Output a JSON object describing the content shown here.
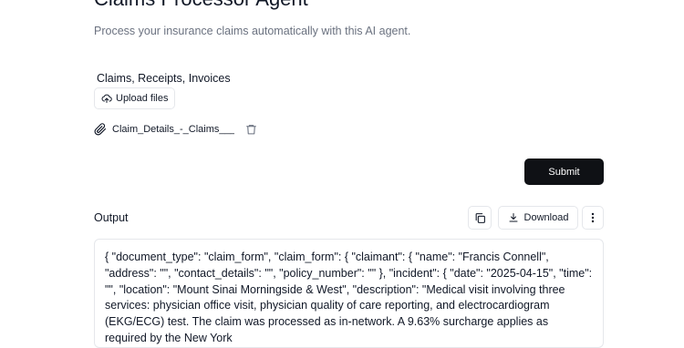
{
  "header": {
    "title": "Claims Processor Agent",
    "subtitle": "Process your insurance claims automatically with this AI agent."
  },
  "uploads": {
    "label": "Claims, Receipts, Invoices",
    "upload_button": "Upload files",
    "files": [
      {
        "name": "Claim_Details_-_Claims___..."
      }
    ]
  },
  "actions": {
    "submit_label": "Submit"
  },
  "output": {
    "label": "Output",
    "download_label": "Download",
    "text": "{ \"document_type\": \"claim_form\", \"claim_form\": { \"claimant\": { \"name\": \"Francis Connell\", \"address\": \"\", \"contact_details\": \"\", \"policy_number\": \"\" }, \"incident\": { \"date\": \"2025-04-15\", \"time\": \"\", \"location\": \"Mount Sinai Morningside & West\", \"description\": \"Medical visit involving three services: physician office visit, physician quality of care reporting, and electrocardiogram (EKG/ECG) test. The claim was processed as in-network. A 9.63% surcharge applies as required by the New York"
  },
  "icons": {
    "upload": "cloud-upload-icon",
    "attachment": "paperclip-icon",
    "delete": "trash-icon",
    "copy": "copy-icon",
    "download": "download-icon",
    "more": "more-vertical-icon"
  }
}
